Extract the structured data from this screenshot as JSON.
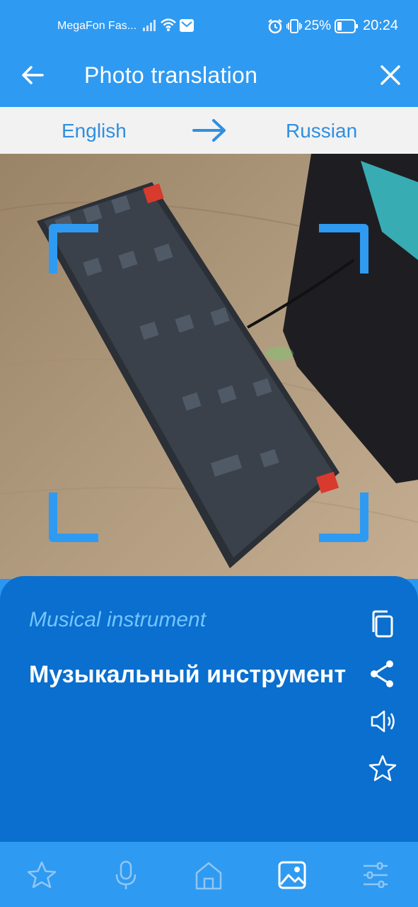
{
  "status_bar": {
    "carrier": "MegaFon Fas...",
    "battery": "25%",
    "time": "20:24",
    "icons": [
      "signal-icon",
      "wifi-icon",
      "message-icon",
      "alarm-icon",
      "vibrate-icon",
      "battery-icon"
    ]
  },
  "app_bar": {
    "title": "Photo translation",
    "back_icon": "arrow-left-icon",
    "close_icon": "close-icon"
  },
  "languages": {
    "source": "English",
    "target": "Russian",
    "swap_icon": "arrow-right-icon"
  },
  "camera": {
    "subject": "keyboard photo",
    "frame_icon": "viewfinder-corner-icon"
  },
  "result": {
    "source_text": "Musical instrument",
    "translated_text": "Музыкальный инструмент",
    "actions": [
      "copy-icon",
      "share-icon",
      "speaker-icon",
      "star-icon"
    ]
  },
  "bottom_nav": {
    "items": [
      "favorites-star-icon",
      "microphone-icon",
      "home-icon",
      "image-icon",
      "settings-sliders-icon"
    ],
    "active": "image-icon"
  },
  "colors": {
    "accent": "#2f9af1",
    "panel": "#0a6fce",
    "source_text": "#74c4ff",
    "language_text": "#2f8fe0"
  }
}
